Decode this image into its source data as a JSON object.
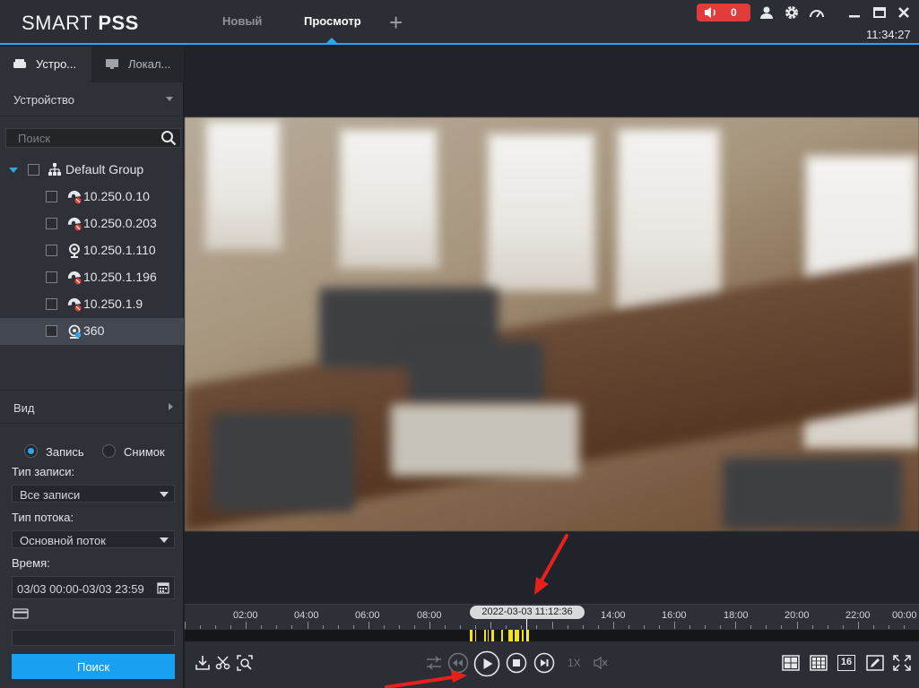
{
  "app": {
    "logo_light": "SMART ",
    "logo_bold": "PSS",
    "tabs": [
      {
        "label": "Новый"
      },
      {
        "label": "Просмотр"
      }
    ],
    "alarm_count": "0",
    "clock": "11:34:27"
  },
  "sidebar": {
    "tabs": [
      {
        "label": "Устро..."
      },
      {
        "label": "Локал..."
      }
    ],
    "device_section": "Устройство",
    "search_placeholder": "Поиск",
    "tree": {
      "root": "Default Group",
      "children": [
        {
          "label": "10.250.0.10",
          "icon": "camera-offline-icon"
        },
        {
          "label": "10.250.0.203",
          "icon": "camera-offline-icon"
        },
        {
          "label": "10.250.1.110",
          "icon": "camera-online-icon"
        },
        {
          "label": "10.250.1.196",
          "icon": "camera-offline-icon"
        },
        {
          "label": "10.250.1.9",
          "icon": "camera-offline-icon"
        },
        {
          "label": "360",
          "icon": "fisheye-camera-icon",
          "selected": true
        }
      ]
    },
    "view_section": "Вид",
    "form": {
      "radio_record": "Запись",
      "radio_snapshot": "Снимок",
      "record_type_label": "Тип записи:",
      "record_type_value": "Все записи",
      "stream_type_label": "Тип потока:",
      "stream_type_value": "Основной поток",
      "time_label": "Время:",
      "time_value": "03/03 00:00-03/03 23:59",
      "search_button": "Поиск"
    }
  },
  "timeline": {
    "labels": [
      "02:00",
      "04:00",
      "06:00",
      "08:00",
      "14:00",
      "16:00",
      "18:00",
      "20:00",
      "22:00",
      "00:00"
    ],
    "current_time": "2022-03-03 11:12:36",
    "record_color": "#f5e11a"
  },
  "controls": {
    "speed": "1X",
    "grid_16": "16"
  },
  "colors": {
    "accent": "#2ea6e8",
    "alarm": "#e23b3b",
    "annotation": "#e8201c"
  }
}
